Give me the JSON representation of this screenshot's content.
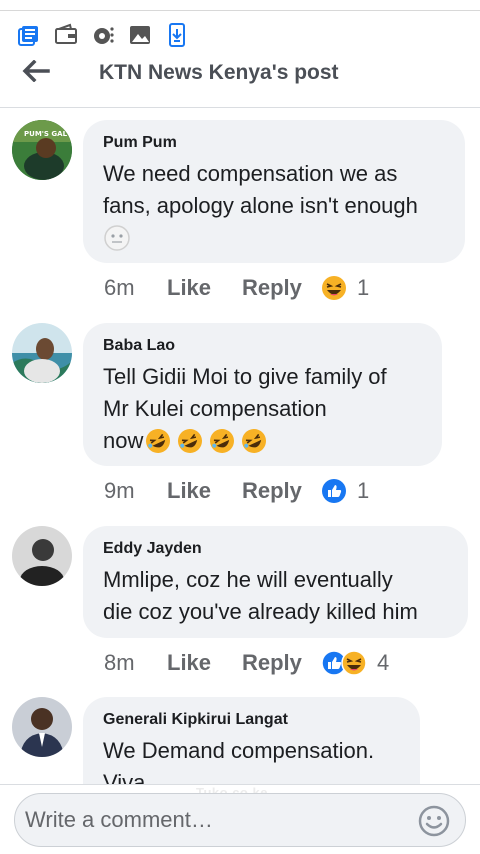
{
  "header": {
    "title": "KTN News Kenya's post"
  },
  "status_icons": [
    "news-icon",
    "wallet-icon",
    "vpn-icon",
    "image-icon",
    "download-icon"
  ],
  "comments": [
    {
      "author": "Pum Pum",
      "avatar_badge": "PUM'S GAL",
      "lines": [
        "We need compensation we as",
        "fans, apology alone isn't enough"
      ],
      "emojis": [
        "neutral-face-emoji"
      ],
      "time": "6m",
      "like": "Like",
      "reply": "Reply",
      "reactions": [
        "haha-reaction"
      ],
      "count": "1"
    },
    {
      "author": "Baba Lao",
      "lines": [
        "Tell Gidii Moi to give family of",
        "Mr Kulei compensation",
        "now"
      ],
      "emojis": [
        "rofl-emoji",
        "rofl-emoji",
        "rofl-emoji",
        "rofl-emoji"
      ],
      "time": "9m",
      "like": "Like",
      "reply": "Reply",
      "reactions": [
        "like-reaction"
      ],
      "count": "1"
    },
    {
      "author": "Eddy Jayden",
      "lines": [
        "Mmlipe, coz he will eventually",
        "die coz you've already killed him"
      ],
      "time": "8m",
      "like": "Like",
      "reply": "Reply",
      "reactions": [
        "like-reaction",
        "haha-reaction"
      ],
      "count": "4"
    },
    {
      "author": "Generali Kipkirui Langat",
      "lines": [
        "We Demand compensation.",
        "Viva"
      ],
      "time": "",
      "like": "",
      "reply": "",
      "reactions": [],
      "count": ""
    }
  ],
  "composer": {
    "placeholder": "Write a comment…",
    "watermark": "Tuko.co.ke"
  },
  "colors": {
    "brand_blue": "#1877f2",
    "bubble_bg": "#f0f2f5",
    "meta_gray": "#65676b",
    "haha_yellow": "#f7b125"
  }
}
